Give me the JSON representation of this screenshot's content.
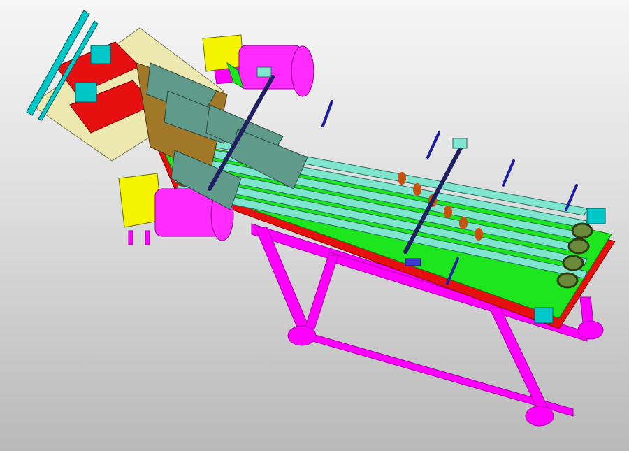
{
  "viewport": {
    "background_top": "#f6f6f6",
    "background_bottom": "#b9b9b9"
  },
  "model": {
    "colors": {
      "frame": "#ff00ff",
      "frame_dark": "#b800b8",
      "belt": "#7fe5cf",
      "lane": "#1ee61e",
      "bed": "#e61010",
      "motor_body": "#ff2bff",
      "gearbox": "#f4f400",
      "guide": "#5f9a8a",
      "bracket": "#a07828",
      "rod": "#1e1ea0",
      "shaft": "#202060",
      "bolt": "#3a3ad0",
      "feed_frame": "#00c8c8",
      "roller": "#00e0e0",
      "panel": "#ece8b0"
    },
    "parts": {
      "belts": 6,
      "motors": 2,
      "legs": 4,
      "guide_plates": 4,
      "adjuster_screws": 5
    }
  }
}
